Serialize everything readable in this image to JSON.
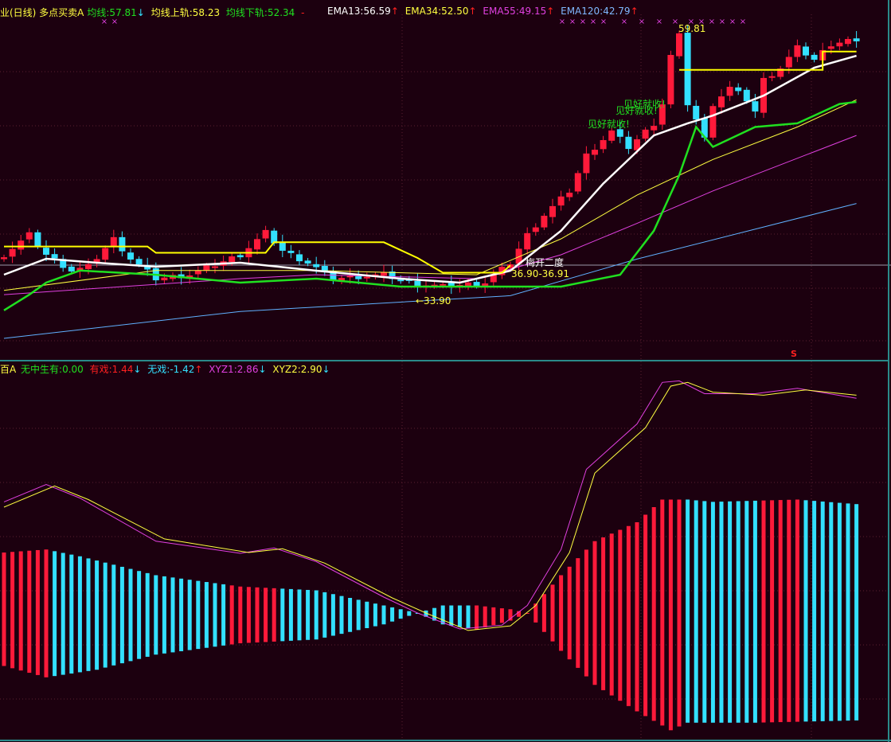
{
  "top_legend": {
    "title": "业(日线) 多点买卖A",
    "ma": "均线:57.81",
    "ma_arrow": "↓",
    "upper": "均线上轨:58.23",
    "lower": "均线下轨:52.34",
    "dash": "-",
    "ema13": "EMA13:56.59",
    "ema34": "EMA34:52.50",
    "ema55": "EMA55:49.15",
    "ema120": "EMA120:42.79",
    "up_arrow": "↑"
  },
  "bottom_legend": {
    "title": "百A",
    "wzsy": "无中生有:0.00",
    "youxi": "有戏:1.44",
    "wuxi": "无戏:-1.42",
    "xyz1": "XYZ1:2.86",
    "xyz2": "XYZ2:2.90",
    "down_arrow": "↓",
    "up_arrow": "↑"
  },
  "annotations": {
    "high": "59.81",
    "low": "←33.90",
    "meikai": "梅开二度",
    "range": "36.90-36.91",
    "take_profit": "见好就收!",
    "marker_s": "S"
  },
  "colors": {
    "bg": "#1c000f",
    "up": "#ff1a3a",
    "down": "#33e0ff",
    "ema13": "#ffffff",
    "ema34": "#ffff40",
    "ema55": "#e040e0",
    "ema120": "#60b0ff",
    "upper": "#ffff00",
    "lower": "#20e020",
    "xyz1": "#e040e0",
    "xyz2": "#ffff40",
    "grid": "#5a2030",
    "border": "#2a8a8a"
  },
  "chart_data": [
    {
      "type": "candlestick",
      "title": "多点买卖A",
      "bars": 102,
      "ylim": [
        28.4,
        62.6
      ],
      "close_keypoints": [
        [
          0,
          38.31
        ],
        [
          3,
          40.21
        ],
        [
          5,
          38.31
        ],
        [
          8,
          36.79
        ],
        [
          10,
          37.17
        ],
        [
          13,
          39.83
        ],
        [
          15,
          37.93
        ],
        [
          18,
          36.03
        ],
        [
          22,
          36.41
        ],
        [
          28,
          38.31
        ],
        [
          31,
          40.43
        ],
        [
          33,
          38.69
        ],
        [
          36,
          37.55
        ],
        [
          39,
          36.03
        ],
        [
          45,
          36.41
        ],
        [
          48,
          35.65
        ],
        [
          52,
          35.27
        ],
        [
          57,
          35.65
        ],
        [
          60,
          37.55
        ],
        [
          62,
          40.21
        ],
        [
          64,
          42.11
        ],
        [
          67,
          44.39
        ],
        [
          69,
          47.81
        ],
        [
          72,
          50.09
        ],
        [
          74,
          48.57
        ],
        [
          77,
          50.85
        ],
        [
          78,
          52.74
        ],
        [
          79,
          57.3
        ],
        [
          80,
          59.2
        ],
        [
          81,
          52.74
        ],
        [
          82,
          51.23
        ],
        [
          83,
          49.33
        ],
        [
          84,
          52.74
        ],
        [
          86,
          54.26
        ],
        [
          88,
          53.12
        ],
        [
          89,
          51.98
        ],
        [
          90,
          55.02
        ],
        [
          92,
          56.16
        ],
        [
          94,
          58.06
        ],
        [
          96,
          56.92
        ],
        [
          98,
          58.44
        ],
        [
          100,
          58.82
        ],
        [
          101,
          58.44
        ]
      ],
      "series": [
        {
          "name": "EMA120",
          "points": [
            [
              0,
              30.33
            ],
            [
              28,
              32.9
            ],
            [
              60,
              34.4
            ],
            [
              75,
              37.9
            ],
            [
              101,
              43.2
            ]
          ]
        },
        {
          "name": "EMA55",
          "points": [
            [
              0,
              34.5
            ],
            [
              28,
              36.03
            ],
            [
              37,
              36.4
            ],
            [
              56,
              36.03
            ],
            [
              66,
              38.31
            ],
            [
              75,
              41.3
            ],
            [
              84,
              44.4
            ],
            [
              101,
              49.7
            ]
          ]
        },
        {
          "name": "EMA34",
          "points": [
            [
              0,
              34.9
            ],
            [
              18,
              36.8
            ],
            [
              37,
              36.8
            ],
            [
              56,
              36.4
            ],
            [
              66,
              39.83
            ],
            [
              75,
              44.0
            ],
            [
              84,
              47.4
            ],
            [
              94,
              50.5
            ],
            [
              101,
              53.1
            ]
          ]
        },
        {
          "name": "EMA13",
          "points": [
            [
              0,
              36.41
            ],
            [
              5,
              37.93
            ],
            [
              11,
              37.55
            ],
            [
              18,
              37.17
            ],
            [
              28,
              37.55
            ],
            [
              37,
              36.79
            ],
            [
              47,
              36.03
            ],
            [
              54,
              35.65
            ],
            [
              60,
              36.79
            ],
            [
              66,
              40.6
            ],
            [
              71,
              45.1
            ],
            [
              77,
              49.7
            ],
            [
              81,
              50.85
            ],
            [
              84,
              51.6
            ],
            [
              90,
              53.5
            ],
            [
              96,
              56.16
            ],
            [
              101,
              57.3
            ]
          ]
        },
        {
          "name": "均线上轨",
          "points": [
            [
              0,
              39.1
            ],
            [
              17,
              39.1
            ],
            [
              18,
              38.5
            ],
            [
              31,
              38.5
            ],
            [
              32,
              39.5
            ],
            [
              45,
              39.5
            ],
            [
              49,
              38.0
            ],
            [
              52,
              36.6
            ],
            [
              59,
              36.6
            ],
            [
              60,
              37.3
            ]
          ]
        },
        {
          "name": "均线上轨2",
          "points": [
            [
              80,
              55.95
            ],
            [
              97,
              55.95
            ],
            [
              97,
              57.7
            ],
            [
              101,
              57.7
            ]
          ]
        },
        {
          "name": "均线下轨",
          "points": [
            [
              0,
              33.0
            ],
            [
              3,
              34.5
            ],
            [
              5,
              35.65
            ],
            [
              9,
              36.8
            ],
            [
              18,
              36.4
            ],
            [
              28,
              35.65
            ],
            [
              37,
              36.03
            ],
            [
              47,
              35.27
            ],
            [
              66,
              35.27
            ],
            [
              73,
              36.4
            ],
            [
              77,
              40.6
            ],
            [
              80,
              45.9
            ],
            [
              82,
              50.5
            ],
            [
              84,
              48.6
            ],
            [
              89,
              50.5
            ],
            [
              94,
              50.85
            ],
            [
              99,
              52.7
            ],
            [
              101,
              52.9
            ]
          ]
        }
      ]
    },
    {
      "type": "bar",
      "title": "无中生有",
      "ylim": [
        -1.7,
        3.3
      ],
      "upper_keypoints": [
        [
          0,
          0.8
        ],
        [
          5,
          0.84
        ],
        [
          9,
          0.75
        ],
        [
          18,
          0.5
        ],
        [
          28,
          0.35
        ],
        [
          37,
          0.3
        ],
        [
          45,
          0.1
        ],
        [
          49,
          0
        ],
        [
          52,
          0.1
        ],
        [
          56,
          0.1
        ],
        [
          60,
          0.05
        ],
        [
          62,
          0
        ],
        [
          66,
          0.5
        ],
        [
          70,
          0.95
        ],
        [
          75,
          1.2
        ],
        [
          78,
          1.5
        ],
        [
          81,
          1.5
        ],
        [
          84,
          1.47
        ],
        [
          94,
          1.5
        ],
        [
          101,
          1.44
        ]
      ],
      "lower_keypoints": [
        [
          0,
          -0.7
        ],
        [
          5,
          -0.85
        ],
        [
          11,
          -0.75
        ],
        [
          18,
          -0.55
        ],
        [
          28,
          -0.4
        ],
        [
          37,
          -0.35
        ],
        [
          45,
          -0.15
        ],
        [
          49,
          0
        ],
        [
          52,
          -0.15
        ],
        [
          56,
          -0.22
        ],
        [
          60,
          -0.1
        ],
        [
          62,
          0
        ],
        [
          66,
          -0.5
        ],
        [
          70,
          -0.95
        ],
        [
          75,
          -1.3
        ],
        [
          79,
          -1.55
        ],
        [
          81,
          -1.45
        ],
        [
          89,
          -1.45
        ],
        [
          101,
          -1.42
        ]
      ],
      "color_runs": [
        [
          0,
          5,
          "up"
        ],
        [
          6,
          26,
          "down"
        ],
        [
          27,
          32,
          "up"
        ],
        [
          33,
          55,
          "down"
        ],
        [
          56,
          80,
          "up"
        ],
        [
          81,
          89,
          "down"
        ],
        [
          90,
          94,
          "up"
        ],
        [
          95,
          101,
          "down"
        ]
      ],
      "series": [
        {
          "name": "XYZ1",
          "points": [
            [
              0,
              1.47
            ],
            [
              5,
              1.7
            ],
            [
              9,
              1.52
            ],
            [
              18,
              0.95
            ],
            [
              28,
              0.79
            ],
            [
              32,
              0.86
            ],
            [
              37,
              0.68
            ],
            [
              45,
              0.21
            ],
            [
              49,
              0
            ],
            [
              54,
              -0.21
            ],
            [
              59,
              -0.16
            ],
            [
              62,
              0.1
            ],
            [
              66,
              0.84
            ],
            [
              69,
              1.9
            ],
            [
              75,
              2.5
            ],
            [
              78,
              3.05
            ],
            [
              80,
              3.07
            ],
            [
              83,
              2.9
            ],
            [
              89,
              2.9
            ],
            [
              94,
              2.97
            ],
            [
              101,
              2.84
            ]
          ]
        },
        {
          "name": "XYZ2",
          "points": [
            [
              0,
              1.4
            ],
            [
              6,
              1.68
            ],
            [
              10,
              1.5
            ],
            [
              19,
              0.98
            ],
            [
              29,
              0.8
            ],
            [
              33,
              0.85
            ],
            [
              38,
              0.66
            ],
            [
              46,
              0.2
            ],
            [
              50,
              0
            ],
            [
              55,
              -0.23
            ],
            [
              60,
              -0.17
            ],
            [
              63,
              0.1
            ],
            [
              67,
              0.8
            ],
            [
              70,
              1.85
            ],
            [
              76,
              2.45
            ],
            [
              79,
              3.0
            ],
            [
              81,
              3.05
            ],
            [
              84,
              2.92
            ],
            [
              90,
              2.88
            ],
            [
              95,
              2.95
            ],
            [
              101,
              2.88
            ]
          ]
        }
      ]
    }
  ]
}
